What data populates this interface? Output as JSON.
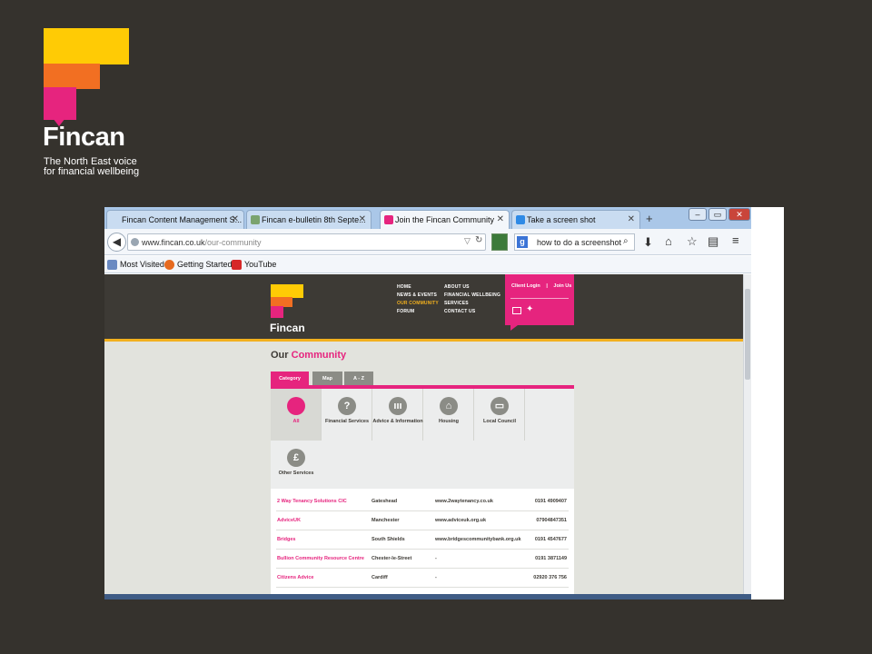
{
  "slide": {
    "brand": "Fincan",
    "tagline": "The North East voice for financial wellbeing"
  },
  "browser": {
    "tabs": [
      {
        "label": "Fincan Content Management S...",
        "active": false
      },
      {
        "label": "Fincan e-bulletin 8th Septe...",
        "active": false
      },
      {
        "label": "Join the Fincan Community",
        "active": true
      },
      {
        "label": "Take a screen shot",
        "active": false
      }
    ],
    "new_tab": "+",
    "url_host": "www.fincan.co.uk",
    "url_path": "/our-community",
    "search_value": "how to do a screenshot",
    "search_engine": "g",
    "bookmarks": [
      "Most Visited",
      "Getting Started",
      "YouTube"
    ],
    "window_controls": [
      "–",
      "▭",
      "✕"
    ]
  },
  "site": {
    "logo_text": "Fincan",
    "nav_left": [
      "HOME",
      "NEWS & EVENTS",
      "OUR COMMUNITY",
      "FORUM"
    ],
    "nav_right": [
      "ABOUT US",
      "FINANCIAL WELLBEING",
      "SERVICES",
      "CONTACT US"
    ],
    "active_nav": "OUR COMMUNITY",
    "login": "Client Login",
    "separator": "|",
    "join": "Join Us",
    "title_plain": "Our",
    "title_highlight": "Community",
    "category_tabs": [
      "Category",
      "Map",
      "A - Z"
    ],
    "categories": [
      {
        "label": "All",
        "icon": "",
        "active": true
      },
      {
        "label": "Financial Services",
        "icon": "?",
        "active": false
      },
      {
        "label": "Advice & Information",
        "icon": "ııı",
        "active": false
      },
      {
        "label": "Housing",
        "icon": "⌂",
        "active": false
      },
      {
        "label": "Local Council",
        "icon": "▭",
        "active": false
      },
      {
        "label": "Other Services",
        "icon": "£",
        "active": false
      }
    ],
    "rows": [
      {
        "name": "2 Way Tenancy Solutions CIC",
        "place": "Gateshead",
        "web": "www.2waytenancy.co.uk",
        "phone": "0191 4909407"
      },
      {
        "name": "AdviceUK",
        "place": "Manchester",
        "web": "www.adviceuk.org.uk",
        "phone": "07904847351"
      },
      {
        "name": "Bridges",
        "place": "South Shields",
        "web": "www.bridgescommunitybank.org.uk",
        "phone": "0191 4547677"
      },
      {
        "name": "Bullion Community Resource Centre",
        "place": "Chester-le-Street",
        "web": "-",
        "phone": "0191 3871149"
      },
      {
        "name": "Citizens Advice",
        "place": "Cardiff",
        "web": "-",
        "phone": "02920 376 756"
      }
    ]
  },
  "colors": {
    "slide_bg": "#35322d",
    "brand_pink": "#e6247e",
    "brand_yellow": "#ffcb05",
    "brand_orange": "#f26f22",
    "header_dark": "#3d3a35"
  }
}
